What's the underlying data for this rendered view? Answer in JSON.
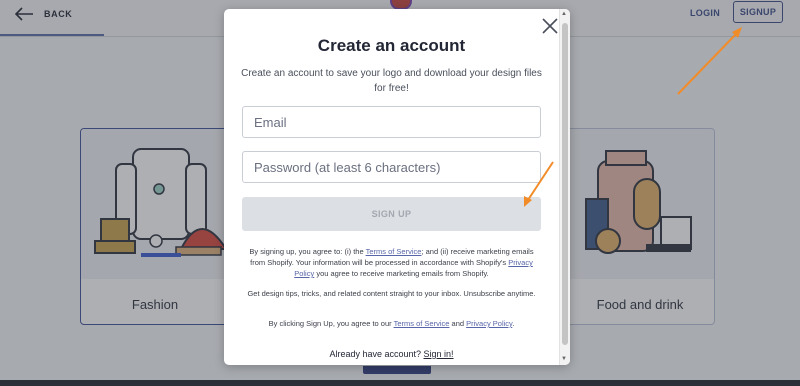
{
  "header": {
    "back_label": "BACK",
    "login_label": "LOGIN",
    "signup_label": "SIGNUP"
  },
  "categories": [
    {
      "label": "Fashion"
    },
    {
      "label": "Food and drink"
    }
  ],
  "modal": {
    "title": "Create an account",
    "subtitle": "Create an account to save your logo and download your design files for free!",
    "email_placeholder": "Email",
    "password_placeholder": "Password (at least 6 characters)",
    "submit_label": "SIGN UP",
    "legal": {
      "p1": "By signing up, you agree to: (i) the ",
      "terms_link": "Terms of Service",
      "p2": "; and (ii) receive marketing emails from Shopify. Your information will be processed in accordance with Shopify's ",
      "privacy_link": "Privacy Policy",
      "p3": " you agree to receive marketing emails from Shopify."
    },
    "tips": "Get design tips, tricks, and related content straight to your inbox. Unsubscribe anytime.",
    "clicking": {
      "p1": "By clicking Sign Up, you agree to our ",
      "terms_link": "Terms of Service",
      "p2": " and ",
      "privacy_link": "Privacy Policy",
      "p3": "."
    },
    "already_text": "Already have account? ",
    "signin_link": "Sign in!"
  },
  "colors": {
    "accent": "#3a4a86",
    "annotation_arrow": "#f28c28"
  }
}
